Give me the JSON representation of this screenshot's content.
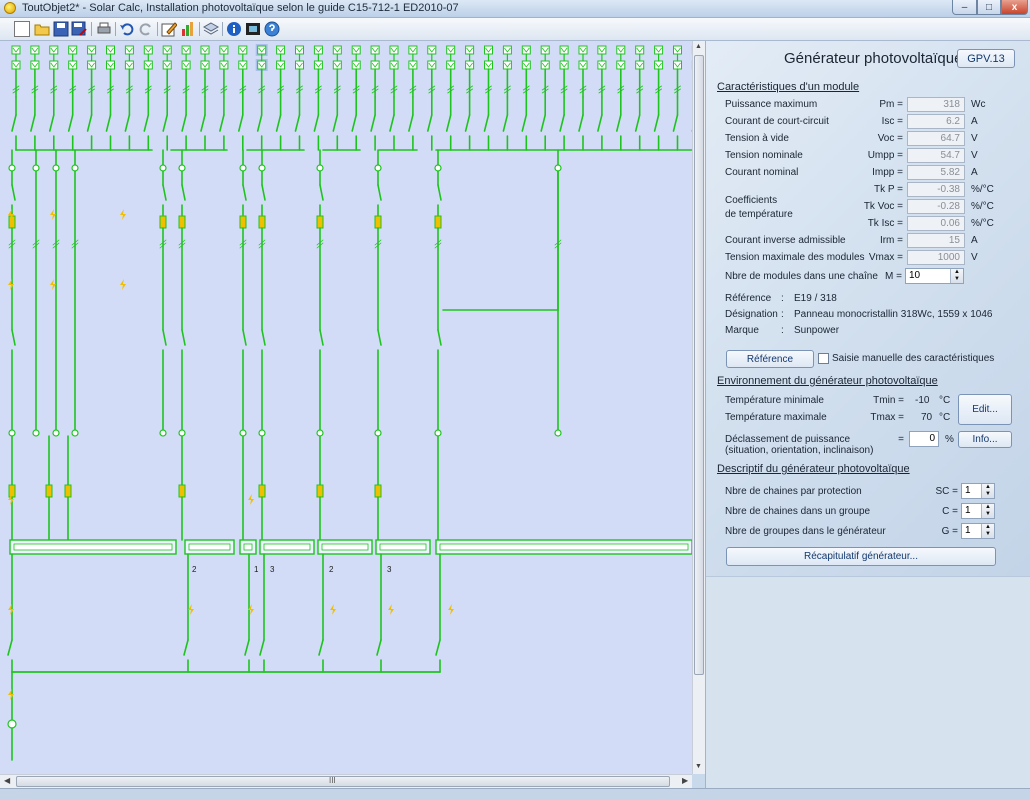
{
  "window": {
    "title": "ToutObjet2* - Solar Calc, Installation photovoltaïque selon le guide C15-712-1 ED2010-07",
    "min_glyph": "–",
    "max_glyph": "□",
    "close_glyph": "x"
  },
  "toolbar": {
    "icons": [
      "new-icon",
      "open-icon",
      "save-icon",
      "save-as-icon",
      "print-icon",
      "undo-icon",
      "redo-icon",
      "edit-icon",
      "chart-icon",
      "layers-icon",
      "info-icon",
      "film-icon",
      "help-icon"
    ]
  },
  "diagram": {
    "string_numbers": [
      "2",
      "1",
      "3",
      "2",
      "3"
    ],
    "scroll_grip": "III"
  },
  "panel": {
    "title": "Générateur photovoltaïque",
    "id_button": "GPV.13",
    "section1": "Caractéristiques d'un module",
    "rows": [
      {
        "label": "Puissance maximum",
        "sym": "Pm =",
        "val": "318",
        "unit": "Wc"
      },
      {
        "label": "Courant de court-circuit",
        "sym": "Isc =",
        "val": "6.2",
        "unit": "A"
      },
      {
        "label": "Tension à vide",
        "sym": "Voc =",
        "val": "64.7",
        "unit": "V"
      },
      {
        "label": "Tension nominale",
        "sym": "Umpp =",
        "val": "54.7",
        "unit": "V"
      },
      {
        "label": "Courant nominal",
        "sym": "Impp =",
        "val": "5.82",
        "unit": "A"
      },
      {
        "label": "",
        "sym": "Tk P =",
        "val": "-0.38",
        "unit": "%/°C"
      },
      {
        "label": "",
        "sym": "Tk Voc =",
        "val": "-0.28",
        "unit": "%/°C"
      },
      {
        "label": "",
        "sym": "Tk Isc =",
        "val": "0.06",
        "unit": "%/°C"
      },
      {
        "label": "Courant inverse admissible",
        "sym": "Irm =",
        "val": "15",
        "unit": "A"
      },
      {
        "label": "Tension maximale des modules",
        "sym": "Vmax =",
        "val": "1000",
        "unit": "V"
      }
    ],
    "coef_label_1": "Coefficients",
    "coef_label_2": "de température",
    "chain_label": "Nbre de modules dans une chaîne",
    "chain_sym": "M =",
    "chain_val": "10",
    "ref_label": "Référence",
    "ref_colon": ":",
    "ref_val": "E19 / 318",
    "desig_label": "Désignation",
    "desig_val": "Panneau monocristallin 318Wc, 1559 x 1046",
    "brand_label": "Marque",
    "brand_val": "Sunpower",
    "ref_button": "Référence",
    "manual_checkbox": "Saisie manuelle des caractéristiques",
    "section2": "Environnement du générateur photovoltaïque",
    "tmin_label": "Température minimale",
    "tmin_sym": "Tmin =",
    "tmin_val": "-10",
    "tmax_label": "Température maximale",
    "tmax_sym": "Tmax =",
    "tmax_val": "70",
    "temp_unit": "°C",
    "edit_button": "Edit...",
    "derate_label_1": "Déclassement de puissance",
    "derate_label_2": "(situation, orientation, inclinaison)",
    "derate_sym": "=",
    "derate_val": "0",
    "derate_unit": "%",
    "info_button": "Info...",
    "section3": "Descriptif du générateur photovoltaïque",
    "desc_rows": [
      {
        "label": "Nbre de chaines par protection",
        "sym": "SC =",
        "val": "1"
      },
      {
        "label": "Nbre de chaines dans un groupe",
        "sym": "C =",
        "val": "1"
      },
      {
        "label": "Nbre de groupes dans le générateur",
        "sym": "G =",
        "val": "1"
      }
    ],
    "summary_button": "Récapitulatif générateur..."
  },
  "colors": {
    "wire": "#1ec41e",
    "diagram_bg": "#d3dcf7",
    "fuse": "#f0c000"
  }
}
